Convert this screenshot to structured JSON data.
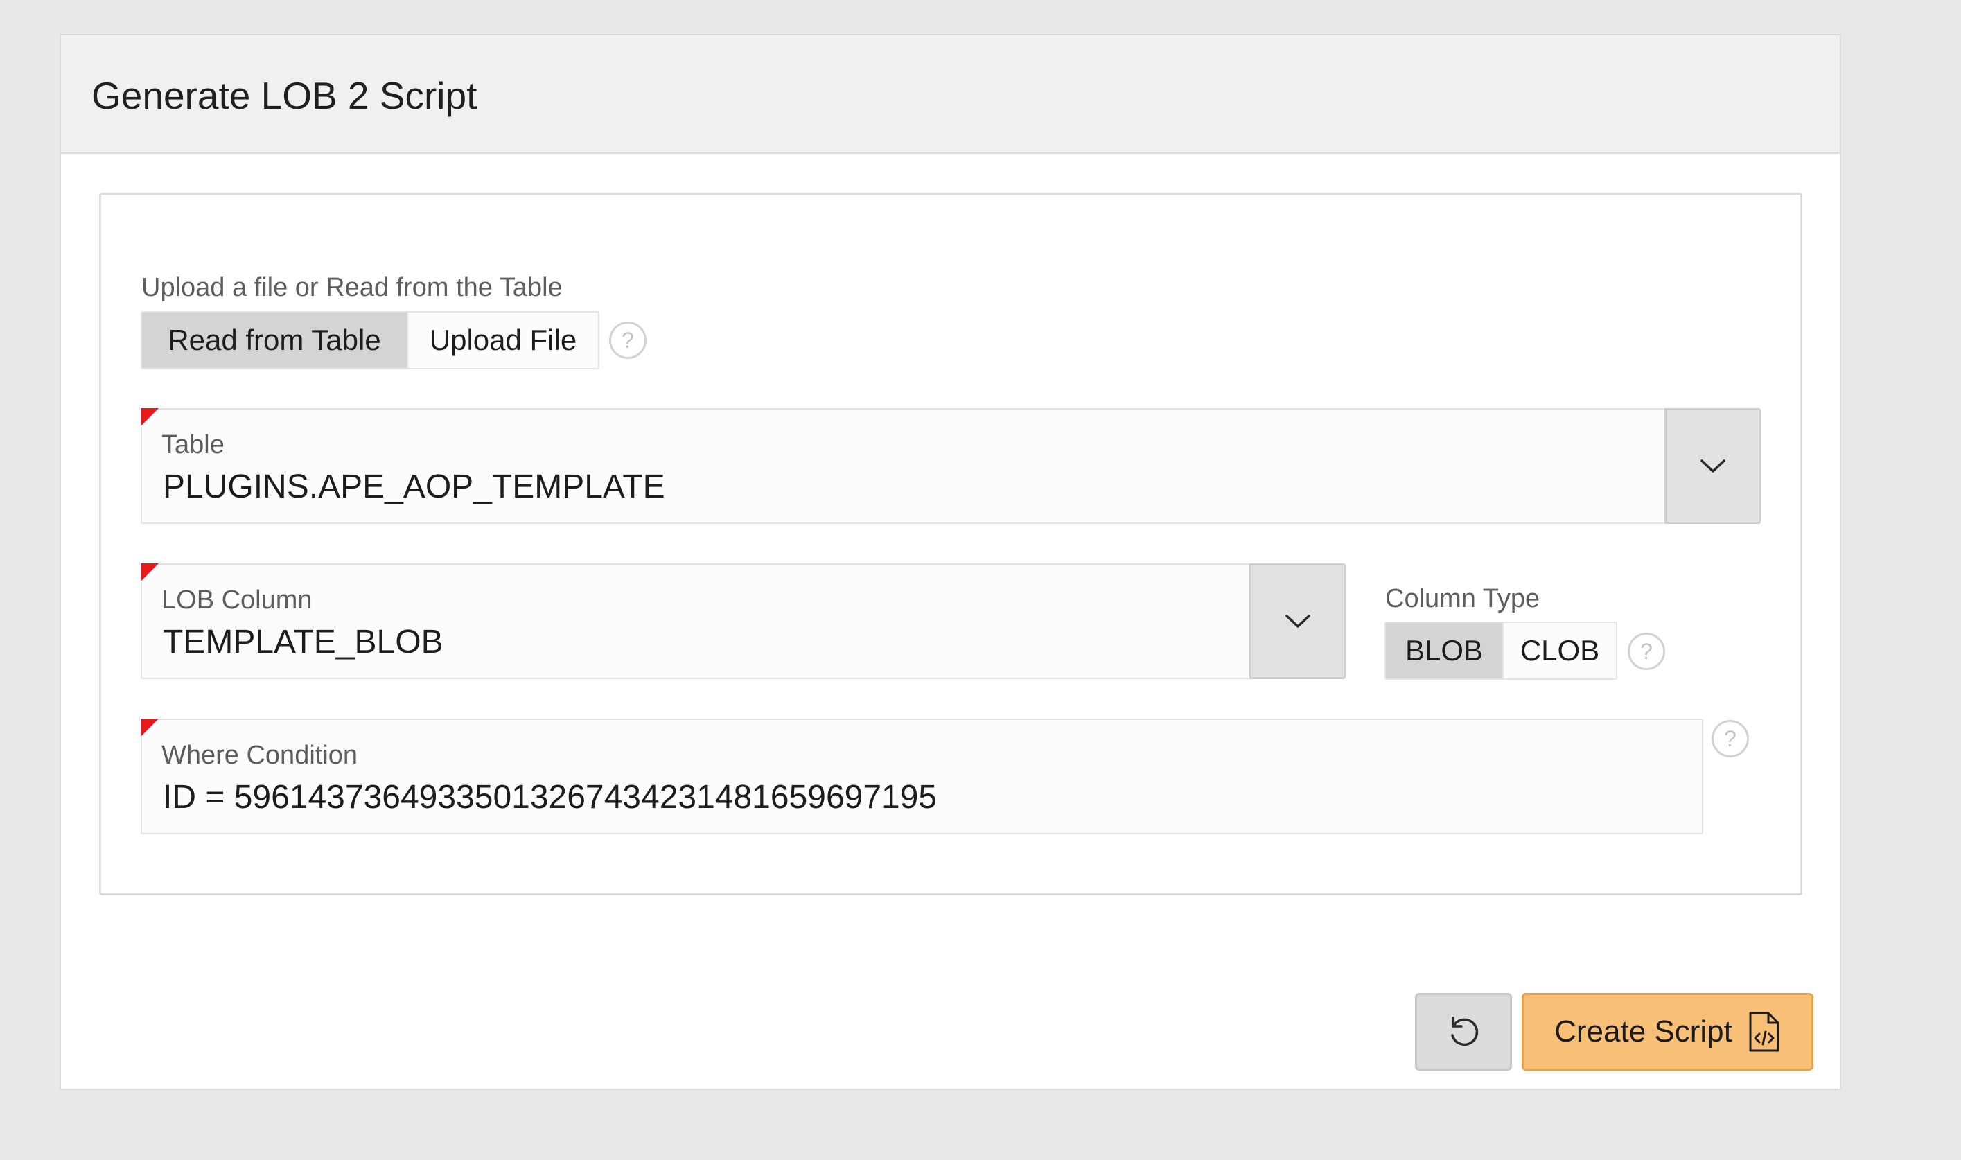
{
  "region": {
    "title": "Generate LOB 2 Script"
  },
  "source": {
    "label": "Upload a file or Read from the Table",
    "options": [
      "Read from Table",
      "Upload File"
    ],
    "selected": "Read from Table",
    "help": "?"
  },
  "table": {
    "label": "Table",
    "value": "PLUGINS.APE_AOP_TEMPLATE"
  },
  "lob_column": {
    "label": "LOB Column",
    "value": "TEMPLATE_BLOB"
  },
  "column_type": {
    "label": "Column Type",
    "options": [
      "BLOB",
      "CLOB"
    ],
    "selected": "BLOB",
    "help": "?"
  },
  "where": {
    "label": "Where Condition",
    "value": "ID = 5961437364933501326743423148165969719​5",
    "help": "?"
  },
  "buttons": {
    "reset_icon": "reset-icon",
    "create_label": "Create Script",
    "create_icon": "file-code-icon"
  },
  "colors": {
    "required": "#e8181d",
    "hot_button": "#f8bf76",
    "active_option": "#d4d4d4"
  }
}
